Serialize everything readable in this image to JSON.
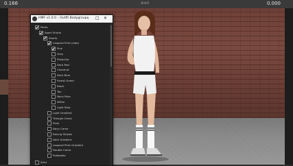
{
  "topbar": {
    "left_value": "0.166",
    "center_label": "dist0",
    "right_value": "0.000"
  },
  "window": {
    "title": "HMF v1.0.0 – Outfit Bodygroups",
    "controls": {
      "minimize": "–",
      "maximize": "□",
      "close": "✕"
    },
    "tree": [
      {
        "label": "Pants",
        "checked": true,
        "indent": 0
      },
      {
        "label": "Sport Shorts",
        "checked": true,
        "indent": 1
      },
      {
        "label": "Shorts",
        "checked": true,
        "indent": 2
      },
      {
        "label": "Leopard Print (side)",
        "checked": true,
        "indent": 3
      },
      {
        "label": "Pink",
        "checked": true,
        "indent": 4
      },
      {
        "label": "Grey",
        "checked": false,
        "indent": 4
      },
      {
        "label": "Pistachio",
        "checked": false,
        "indent": 4
      },
      {
        "label": "Dark Red",
        "checked": false,
        "indent": 4
      },
      {
        "label": "Chestnut",
        "checked": false,
        "indent": 4
      },
      {
        "label": "Dark Blue",
        "checked": false,
        "indent": 4
      },
      {
        "label": "Forest Green",
        "checked": false,
        "indent": 4
      },
      {
        "label": "Black",
        "checked": false,
        "indent": 4
      },
      {
        "label": "Tan",
        "checked": false,
        "indent": 4
      },
      {
        "label": "Navy Blue",
        "checked": false,
        "indent": 4
      },
      {
        "label": "White",
        "checked": false,
        "indent": 4
      },
      {
        "label": "Light Blue",
        "checked": false,
        "indent": 4
      },
      {
        "label": "Light Gradient",
        "checked": false,
        "indent": 3
      },
      {
        "label": "Triangle Camo",
        "checked": false,
        "indent": 3
      },
      {
        "label": "Plain",
        "checked": false,
        "indent": 3
      },
      {
        "label": "Navy Camo",
        "checked": false,
        "indent": 3
      },
      {
        "label": "Racing Stripes",
        "checked": false,
        "indent": 3
      },
      {
        "label": "Dark Gradient",
        "checked": false,
        "indent": 3
      },
      {
        "label": "Leopard Print Gradient",
        "checked": false,
        "indent": 3
      },
      {
        "label": "Double Camo",
        "checked": false,
        "indent": 3
      },
      {
        "label": "Polkadots",
        "checked": false,
        "indent": 3
      },
      {
        "label": "Shirt",
        "checked": false,
        "indent": 0
      }
    ]
  },
  "colors": {
    "wall": "#7a4a40",
    "floor": "#8e8e8e",
    "panel": "#232323",
    "title_bar": "#f4f4f4"
  }
}
